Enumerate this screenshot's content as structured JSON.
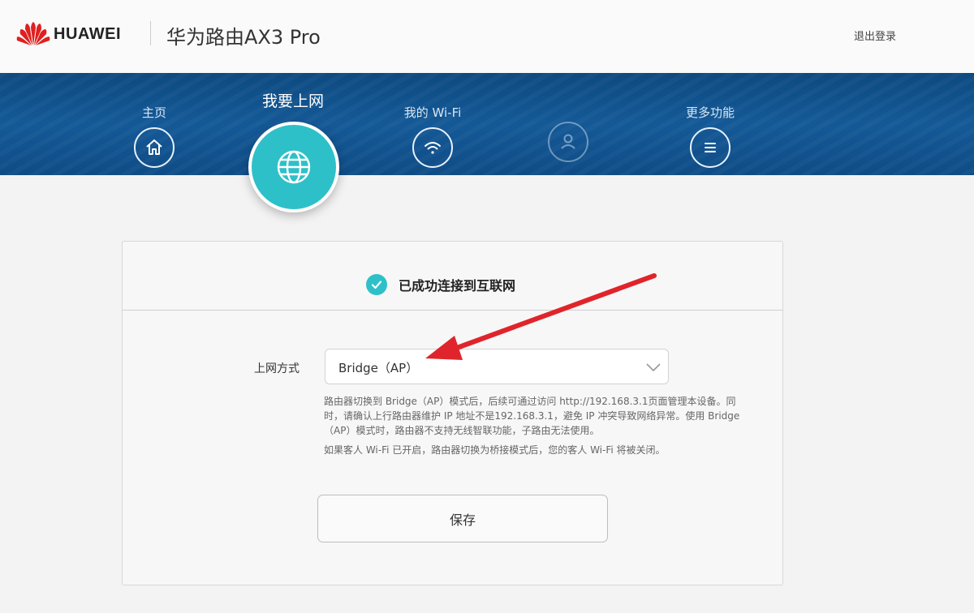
{
  "header": {
    "brand": "HUAWEI",
    "product": "华为路由AX3 Pro",
    "logout_label": "退出登录",
    "logo_icon": "huawei-logo"
  },
  "nav": {
    "home": {
      "label": "主页",
      "icon": "home-icon"
    },
    "internet": {
      "label": "我要上网",
      "icon": "globe-icon"
    },
    "wifi": {
      "label": "我的 Wi-Fi",
      "icon": "wifi-icon"
    },
    "devices": {
      "label": "",
      "icon": "user-icon"
    },
    "more": {
      "label": "更多功能",
      "icon": "menu-icon"
    }
  },
  "status": {
    "text": "已成功连接到互联网",
    "icon": "check-icon"
  },
  "form": {
    "field_label": "上网方式",
    "selected_value": "Bridge（AP）",
    "note_1": "路由器切换到 Bridge（AP）模式后，后续可通过访问 http://192.168.3.1页面管理本设备。同时，请确认上行路由器维护 IP 地址不是192.168.3.1，避免 IP 冲突导致网络异常。使用 Bridge（AP）模式时，路由器不支持无线智联功能，子路由无法使用。",
    "note_2": "如果客人 Wi-Fi 已开启，路由器切换为桥接模式后，您的客人 Wi-Fi 将被关闭。",
    "save_label": "保存"
  },
  "colors": {
    "accent": "#2ec0c8",
    "nav_band": "#145997",
    "annotation_arrow": "#e0242b"
  }
}
